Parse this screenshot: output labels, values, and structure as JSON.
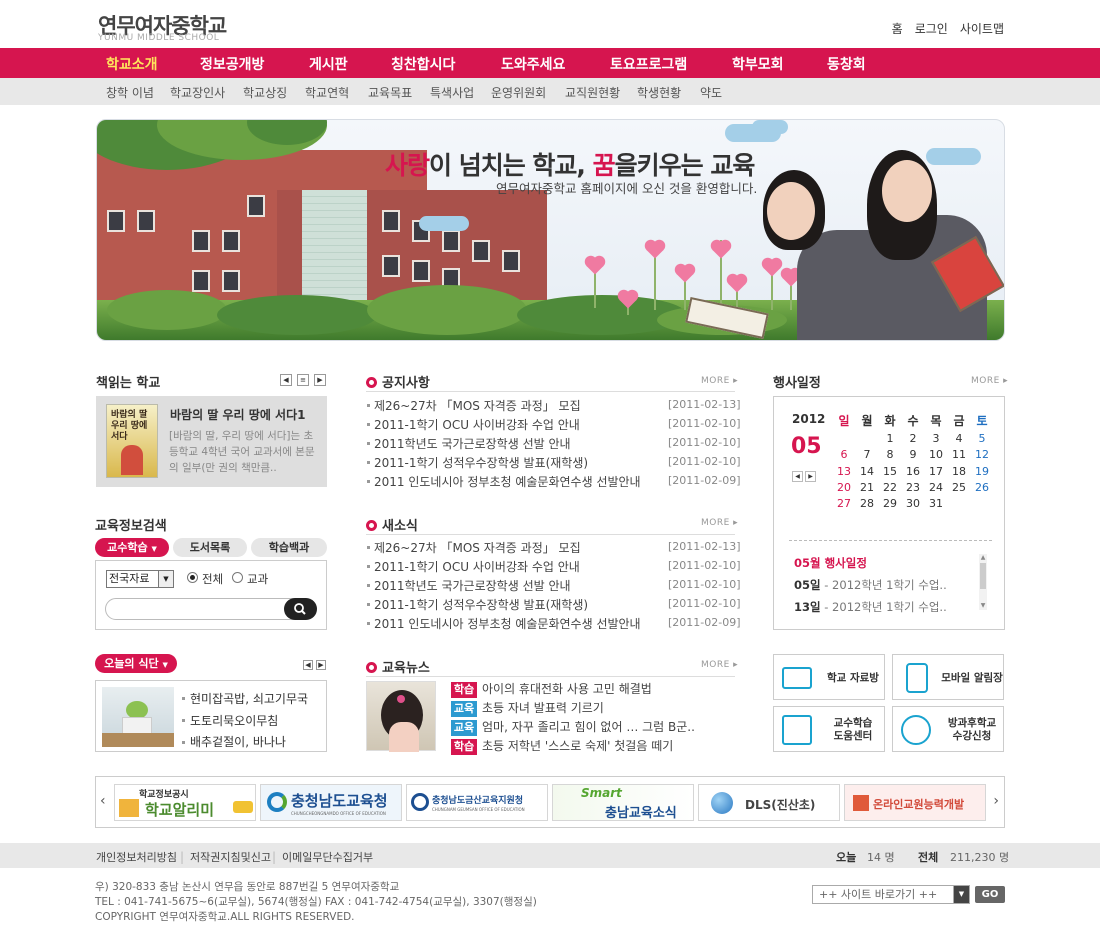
{
  "header": {
    "logo_ko": "연무여자중학교",
    "logo_en": "YUNMU MIDDLE SCHOOL",
    "util": [
      "홈",
      "로그인",
      "사이트맵"
    ]
  },
  "gnb": [
    "학교소개",
    "정보공개방",
    "게시판",
    "칭찬합시다",
    "도와주세요",
    "토요프로그램",
    "학부모회",
    "동창회"
  ],
  "lnb": [
    "창학 이념",
    "학교장인사",
    "학교상징",
    "학교연혁",
    "교육목표",
    "특색사업",
    "운영위원회",
    "교직원현황",
    "학생현황",
    "약도"
  ],
  "banner": {
    "slogan_1": "사랑",
    "slogan_2": "이 넘치는 학교, ",
    "slogan_3": "꿈",
    "slogan_4": "을키우는 교육",
    "subtitle": "연무여자중학교 홈페이지에 오신 것을 환영합니다."
  },
  "books": {
    "title": "책읽는 학교",
    "book_title": "바람의 딸 우리 땅에 서다1",
    "book_cover_text": "바람의 딸 우리 땅에 서다",
    "desc": "[바람의 딸, 우리 땅에 서다]는 초등학교 4학년 국어 교과서에 본문의 일부(만 권의 책만큼.."
  },
  "search": {
    "title": "교육정보검색",
    "tabs": [
      "교수학습",
      "도서목록",
      "학습백과"
    ],
    "select_value": "전국자료",
    "radio": [
      "전체",
      "교과"
    ]
  },
  "lunch": {
    "title": "오늘의 식단",
    "items": [
      "현미잡곡밥, 쇠고기무국",
      "도토리묵오이무침",
      "배추겉절이, 바나나"
    ]
  },
  "notice": {
    "title": "공지사항",
    "more": "MORE",
    "items": [
      {
        "text": "제26~27차 「MOS 자격증 과정」 모집",
        "date": "[2011-02-13]"
      },
      {
        "text": "2011-1학기 OCU 사이버강좌 수업 안내",
        "date": "[2011-02-10]"
      },
      {
        "text": "2011학년도 국가근로장학생 선발 안내",
        "date": "[2011-02-10]"
      },
      {
        "text": "2011-1학기 성적우수장학생 발표(재학생)",
        "date": "[2011-02-10]"
      },
      {
        "text": "2011 인도네시아 정부초청 예술문화연수생 선발안내",
        "date": "[2011-02-09]"
      }
    ]
  },
  "news": {
    "title": "새소식",
    "more": "MORE",
    "items": [
      {
        "text": "제26~27차 「MOS 자격증 과정」 모집",
        "date": "[2011-02-13]"
      },
      {
        "text": "2011-1학기 OCU 사이버강좌 수업 안내",
        "date": "[2011-02-10]"
      },
      {
        "text": "2011학년도 국가근로장학생 선발 안내",
        "date": "[2011-02-10]"
      },
      {
        "text": "2011-1학기 성적우수장학생 발표(재학생)",
        "date": "[2011-02-10]"
      },
      {
        "text": "2011 인도네시아 정부초청 예술문화연수생 선발안내",
        "date": "[2011-02-09]"
      }
    ]
  },
  "edu_news": {
    "title": "교육뉴스",
    "more": "MORE",
    "items": [
      {
        "tag": "학습",
        "tag_color": "#d6154f",
        "text": "아이의 휴대전화 사용 고민 해결법"
      },
      {
        "tag": "교육",
        "tag_color": "#2d9ad0",
        "text": "초등 자녀 발표력 기르기"
      },
      {
        "tag": "교육",
        "tag_color": "#2d9ad0",
        "text": "엄마, 자꾸 졸리고 힘이 없어 … 그럼 B군.."
      },
      {
        "tag": "학습",
        "tag_color": "#d6154f",
        "text": "초등 저학년 '스스로 숙제' 첫걸음 떼기"
      }
    ]
  },
  "calendar": {
    "title": "행사일정",
    "more": "MORE",
    "year": "2012",
    "month": "05",
    "weekdays": [
      "일",
      "월",
      "화",
      "수",
      "목",
      "금",
      "토"
    ],
    "weeks": [
      [
        "",
        "",
        "1",
        "2",
        "3",
        "4",
        "5"
      ],
      [
        "6",
        "7",
        "8",
        "9",
        "10",
        "11",
        "12"
      ],
      [
        "13",
        "14",
        "15",
        "16",
        "17",
        "18",
        "19"
      ],
      [
        "20",
        "21",
        "22",
        "23",
        "24",
        "25",
        "26"
      ],
      [
        "27",
        "28",
        "29",
        "30",
        "31",
        "",
        ""
      ]
    ],
    "events_title": "05월 행사일정",
    "events": [
      {
        "day": "05일",
        "text": "- 2012학년 1학기 수업.."
      },
      {
        "day": "13일",
        "text": "- 2012학년 1학기 수업.."
      }
    ]
  },
  "quick": [
    {
      "label": "학교 자료방",
      "icon": "folder-icon"
    },
    {
      "label": "모바일 알림장",
      "icon": "mobile-icon"
    },
    {
      "label": "교수학습\n도움센터",
      "icon": "search-doc-icon"
    },
    {
      "label": "방과후학교\n수강신청",
      "icon": "target-icon"
    }
  ],
  "link_banners": [
    {
      "top": "학교정보공시",
      "main": "학교알리미"
    },
    {
      "main": "충청남도교육청",
      "sub": "CHUNGCHEONGNAMDO OFFICE OF EDUCATION"
    },
    {
      "main": "충청남도금산교육지원청",
      "sub": "CHUNGNAM GEUMSAN OFFICE OF EDUCATION"
    },
    {
      "top": "Smart",
      "main": "충남교육소식"
    },
    {
      "main": "DLS(진산초)"
    },
    {
      "main": "온라인교원능력개발"
    }
  ],
  "footer": {
    "links": [
      "개인정보처리방침",
      "저작권지침및신고",
      "이메일무단수집거부"
    ],
    "today_label": "오늘",
    "today_value": "14 명",
    "total_label": "전체",
    "total_value": "211,230 명",
    "address": "우) 320-833 충남 논산시 연무읍 동안로 887번길 5 연무여자중학교",
    "tel": "TEL : 041-741-5675~6(교무실), 5674(행정실) FAX : 041-742-4754(교무실), 3307(행정실)",
    "copyright": "COPYRIGHT 연무여자중학교.ALL RIGHTS RESERVED.",
    "site_select": "++ 사이트 바로가기 ++",
    "go": "GO"
  },
  "colors": {
    "accent": "#d6154f",
    "blue": "#2d9ad0"
  }
}
